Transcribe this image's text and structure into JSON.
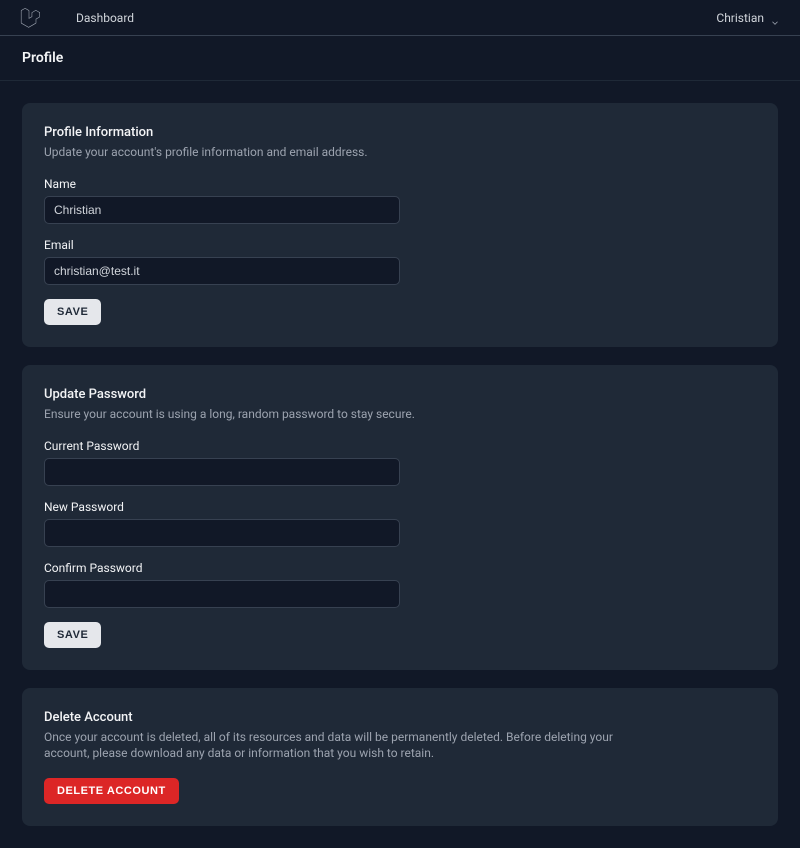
{
  "nav": {
    "dashboard_label": "Dashboard",
    "user_name": "Christian"
  },
  "page": {
    "title": "Profile"
  },
  "profile_info": {
    "title": "Profile Information",
    "desc": "Update your account's profile information and email address.",
    "name_label": "Name",
    "name_value": "Christian",
    "email_label": "Email",
    "email_value": "christian@test.it",
    "save_label": "Save"
  },
  "update_password": {
    "title": "Update Password",
    "desc": "Ensure your account is using a long, random password to stay secure.",
    "current_label": "Current Password",
    "current_value": "",
    "new_label": "New Password",
    "new_value": "",
    "confirm_label": "Confirm Password",
    "confirm_value": "",
    "save_label": "Save"
  },
  "delete_account": {
    "title": "Delete Account",
    "desc": "Once your account is deleted, all of its resources and data will be permanently deleted. Before deleting your account, please download any data or information that you wish to retain.",
    "button_label": "Delete Account"
  }
}
